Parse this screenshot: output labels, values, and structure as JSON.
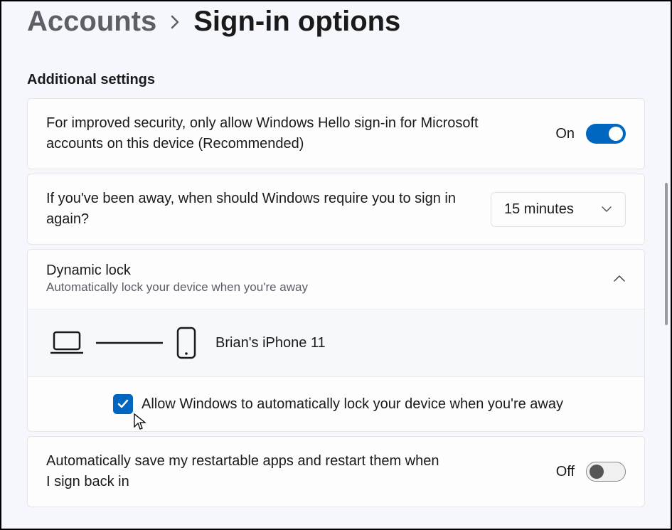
{
  "breadcrumb": {
    "parent": "Accounts",
    "current": "Sign-in options"
  },
  "section_header": "Additional settings",
  "hello_card": {
    "text": "For improved security, only allow Windows Hello sign-in for Microsoft accounts on this device (Recommended)",
    "state_label": "On",
    "state_on": true
  },
  "away_card": {
    "text": "If you've been away, when should Windows require you to sign in again?",
    "dropdown_value": "15 minutes"
  },
  "dynamic_lock": {
    "title": "Dynamic lock",
    "subtitle": "Automatically lock your device when you're away",
    "device_name": "Brian's iPhone 11",
    "checkbox_label": "Allow Windows to automatically lock your device when you're away",
    "checkbox_checked": true
  },
  "restart_card": {
    "text": "Automatically save my restartable apps and restart them when I sign back in",
    "state_label": "Off",
    "state_on": false
  }
}
